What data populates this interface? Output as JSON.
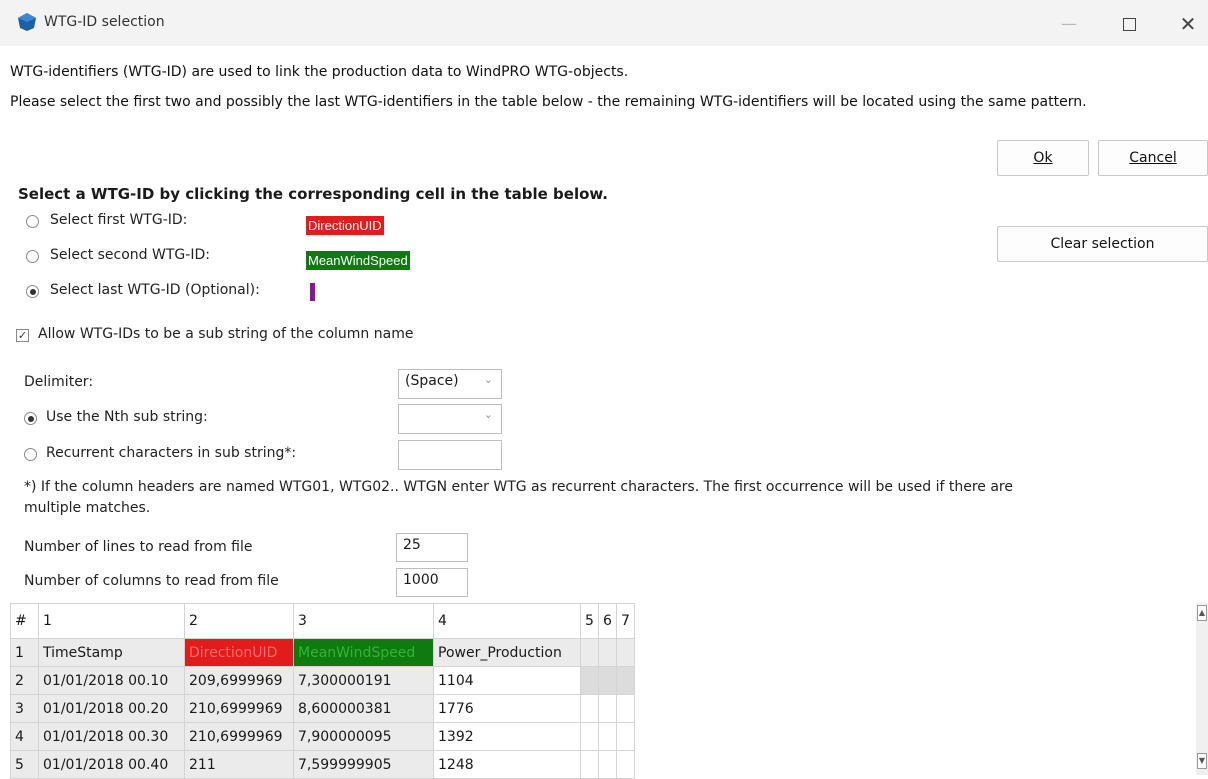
{
  "window": {
    "title": "WTG-ID selection",
    "controls": {
      "minimize": "—",
      "maximize": "",
      "close": "✕"
    }
  },
  "intro": {
    "line1": "WTG-identifiers (WTG-ID) are used to link the production data to WindPRO WTG-objects.",
    "line2": "Please select the first two and possibly the last WTG-identifiers in the table below - the remaining WTG-identifiers will be located using the same pattern."
  },
  "buttons": {
    "ok": "Ok",
    "cancel": "Cancel",
    "clear": "Clear selection"
  },
  "selection": {
    "heading": "Select a WTG-ID by clicking the corresponding cell in the table below.",
    "first_label": "Select first WTG-ID:",
    "first_value": "DirectionUID",
    "first_color": "#e21b1b",
    "second_label": "Select second WTG-ID:",
    "second_value": "MeanWindSpeed",
    "second_color": "#0f7a0f",
    "last_label": "Select last WTG-ID (Optional):",
    "last_marker_color": "#8a1a8a",
    "selected": "last"
  },
  "allow_substring": {
    "label": "Allow WTG-IDs to be a sub string of the column name",
    "checked": true
  },
  "delimiter": {
    "label": "Delimiter:",
    "value": "(Space)"
  },
  "nth_substring": {
    "label": "Use the Nth sub string:",
    "value": "",
    "selected": true
  },
  "recurrent": {
    "label": "Recurrent characters in sub string*:",
    "value": "",
    "selected": false
  },
  "note": "*) If the column headers are named WTG01, WTG02.. WTGN enter WTG as recurrent characters. The first occurrence will be used if there are multiple matches.",
  "lines_to_read": {
    "label": "Number of lines to read from file",
    "value": "25"
  },
  "columns_to_read": {
    "label": "Number of columns to read from file",
    "value": "1000"
  },
  "table": {
    "header": [
      "#",
      "1",
      "2",
      "3",
      "4",
      "5",
      "6",
      "7"
    ],
    "rows": [
      [
        "1",
        "TimeStamp",
        "DirectionUID",
        "MeanWindSpeed",
        "Power_Production"
      ],
      [
        "2",
        "01/01/2018 00.10",
        "209,6999969",
        "7,300000191",
        "1104"
      ],
      [
        "3",
        "01/01/2018 00.20",
        "210,6999969",
        "8,600000381",
        "1776"
      ],
      [
        "4",
        "01/01/2018 00.30",
        "210,6999969",
        "7,900000095",
        "1392"
      ],
      [
        "5",
        "01/01/2018 00.40",
        "211",
        "7,599999905",
        "1248"
      ]
    ]
  }
}
